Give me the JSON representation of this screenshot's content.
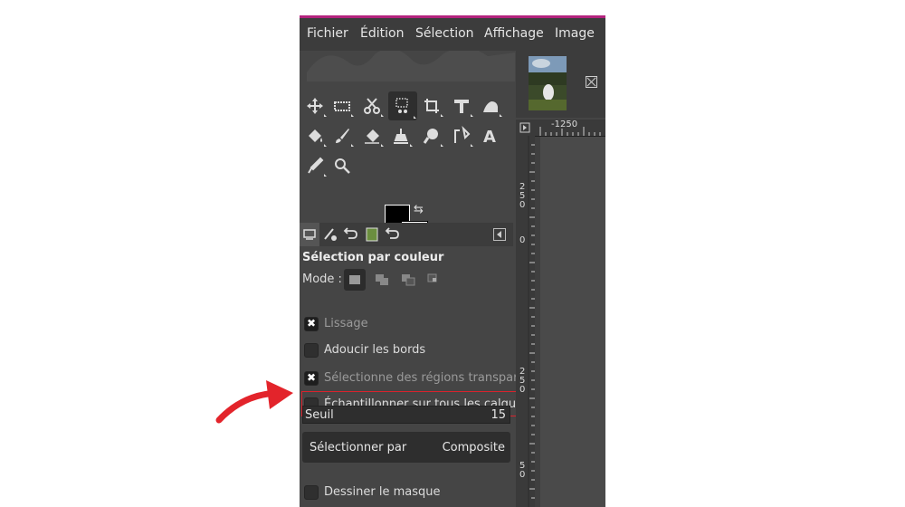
{
  "menu": {
    "items": [
      {
        "label": "Fichier"
      },
      {
        "label": "Édition"
      },
      {
        "label": "Sélection"
      },
      {
        "label": "Affichage"
      },
      {
        "label": "Image"
      }
    ]
  },
  "tool_options": {
    "title": "Sélection par couleur",
    "mode_label": "Mode :",
    "options": [
      {
        "label": "Lissage",
        "checked": true,
        "dim": true
      },
      {
        "label": "Adoucir les bords",
        "checked": false,
        "dim": false
      },
      {
        "label": "Sélectionne des régions transpare",
        "checked": true,
        "dim": true
      },
      {
        "label": "Échantillonner sur tous les calques",
        "checked": false,
        "dim": false,
        "highlighted": true
      }
    ],
    "seuil": {
      "label": "Seuil",
      "value": "15"
    },
    "select_by": {
      "label": "Sélectionner par",
      "value": "Composite"
    },
    "draw_mask": {
      "label": "Dessiner le masque",
      "checked": false
    }
  },
  "rulers": {
    "top_label": "-1250",
    "left_labels": [
      "2\n5\n0",
      "0",
      "2\n5\n0",
      "5\n0"
    ]
  },
  "colors": {
    "accent_line": "#b3237e",
    "highlight_border": "#d9232d",
    "arrow": "#e3242b"
  }
}
